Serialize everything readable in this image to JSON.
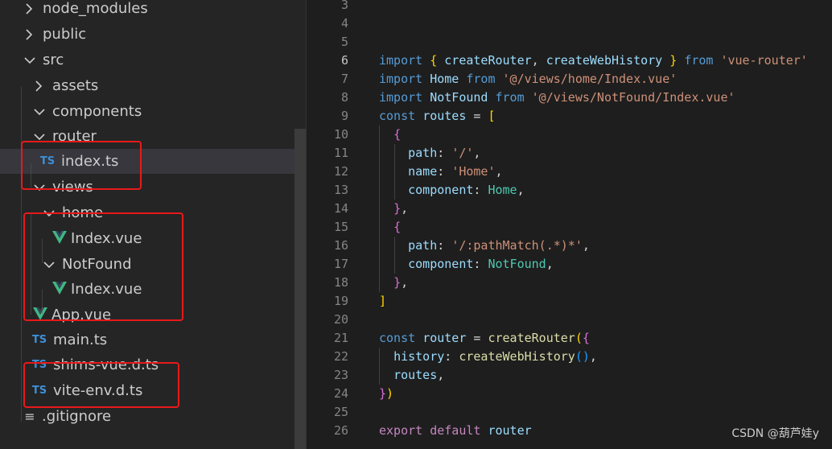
{
  "explorer": {
    "items": [
      {
        "label": "node_modules",
        "icon": "chevron-right-icon"
      },
      {
        "label": "public",
        "icon": "chevron-right-icon"
      },
      {
        "label": "src",
        "icon": "chevron-down-icon"
      },
      {
        "label": "assets",
        "icon": "chevron-right-icon"
      },
      {
        "label": "components",
        "icon": "chevron-down-icon"
      },
      {
        "label": "router",
        "icon": "chevron-down-icon"
      },
      {
        "label": "index.ts",
        "icon": "typescript-file-icon",
        "badge": "TS"
      },
      {
        "label": "views",
        "icon": "chevron-down-icon"
      },
      {
        "label": "home",
        "icon": "chevron-down-icon"
      },
      {
        "label": "Index.vue",
        "icon": "vue-file-icon"
      },
      {
        "label": "NotFound",
        "icon": "chevron-down-icon"
      },
      {
        "label": "Index.vue",
        "icon": "vue-file-icon"
      },
      {
        "label": "App.vue",
        "icon": "vue-file-icon"
      },
      {
        "label": "main.ts",
        "icon": "typescript-file-icon",
        "badge": "TS"
      },
      {
        "label": "shims-vue.d.ts",
        "icon": "typescript-file-icon",
        "badge": "TS"
      },
      {
        "label": "vite-env.d.ts",
        "icon": "typescript-file-icon",
        "badge": "TS"
      },
      {
        "label": ".gitignore",
        "icon": "lines-file-icon"
      }
    ]
  },
  "editor": {
    "line_numbers": [
      "3",
      "4",
      "5",
      "6",
      "7",
      "8",
      "9",
      "10",
      "11",
      "12",
      "13",
      "14",
      "15",
      "16",
      "17",
      "18",
      "19",
      "20",
      "21",
      "22",
      "23",
      "24",
      "25",
      "26"
    ],
    "active_line": "6",
    "lines": [
      [],
      [],
      [],
      [
        [
          "kw",
          "import"
        ],
        [
          "punc",
          " "
        ],
        [
          "b1",
          "{"
        ],
        [
          "punc",
          " "
        ],
        [
          "var",
          "createRouter"
        ],
        [
          "punc",
          ", "
        ],
        [
          "var",
          "createWebHistory"
        ],
        [
          "punc",
          " "
        ],
        [
          "b1",
          "}"
        ],
        [
          "punc",
          " "
        ],
        [
          "kw",
          "from"
        ],
        [
          "punc",
          " "
        ],
        [
          "str",
          "'vue-router'"
        ]
      ],
      [
        [
          "kw",
          "import"
        ],
        [
          "punc",
          " "
        ],
        [
          "var",
          "Home"
        ],
        [
          "punc",
          " "
        ],
        [
          "kw",
          "from"
        ],
        [
          "punc",
          " "
        ],
        [
          "str",
          "'@/views/home/Index.vue'"
        ]
      ],
      [
        [
          "kw",
          "import"
        ],
        [
          "punc",
          " "
        ],
        [
          "var",
          "NotFound"
        ],
        [
          "punc",
          " "
        ],
        [
          "kw",
          "from"
        ],
        [
          "punc",
          " "
        ],
        [
          "str",
          "'@/views/NotFound/Index.vue'"
        ]
      ],
      [
        [
          "kw",
          "const"
        ],
        [
          "punc",
          " "
        ],
        [
          "var",
          "routes"
        ],
        [
          "punc",
          " = "
        ],
        [
          "b1",
          "["
        ]
      ],
      [
        [
          "punc",
          "  "
        ],
        [
          "b2",
          "{"
        ]
      ],
      [
        [
          "punc",
          "    "
        ],
        [
          "var",
          "path"
        ],
        [
          "punc",
          ": "
        ],
        [
          "str",
          "'/'"
        ],
        [
          "punc",
          ","
        ]
      ],
      [
        [
          "punc",
          "    "
        ],
        [
          "var",
          "name"
        ],
        [
          "punc",
          ": "
        ],
        [
          "str",
          "'Home'"
        ],
        [
          "punc",
          ","
        ]
      ],
      [
        [
          "punc",
          "    "
        ],
        [
          "var",
          "component"
        ],
        [
          "punc",
          ": "
        ],
        [
          "typ",
          "Home"
        ],
        [
          "punc",
          ","
        ]
      ],
      [
        [
          "punc",
          "  "
        ],
        [
          "b2",
          "}"
        ],
        [
          "punc",
          ","
        ]
      ],
      [
        [
          "punc",
          "  "
        ],
        [
          "b2",
          "{"
        ]
      ],
      [
        [
          "punc",
          "    "
        ],
        [
          "var",
          "path"
        ],
        [
          "punc",
          ": "
        ],
        [
          "str",
          "'/:pathMatch(.*)*'"
        ],
        [
          "punc",
          ","
        ]
      ],
      [
        [
          "punc",
          "    "
        ],
        [
          "var",
          "component"
        ],
        [
          "punc",
          ": "
        ],
        [
          "typ",
          "NotFound"
        ],
        [
          "punc",
          ","
        ]
      ],
      [
        [
          "punc",
          "  "
        ],
        [
          "b2",
          "}"
        ],
        [
          "punc",
          ","
        ]
      ],
      [
        [
          "b1",
          "]"
        ]
      ],
      [],
      [
        [
          "kw",
          "const"
        ],
        [
          "punc",
          " "
        ],
        [
          "var",
          "router"
        ],
        [
          "punc",
          " = "
        ],
        [
          "fn",
          "createRouter"
        ],
        [
          "b1",
          "("
        ],
        [
          "b2",
          "{"
        ]
      ],
      [
        [
          "punc",
          "  "
        ],
        [
          "var",
          "history"
        ],
        [
          "punc",
          ": "
        ],
        [
          "fn",
          "createWebHistory"
        ],
        [
          "b3",
          "()"
        ],
        [
          "punc",
          ","
        ]
      ],
      [
        [
          "punc",
          "  "
        ],
        [
          "var",
          "routes"
        ],
        [
          "punc",
          ","
        ]
      ],
      [
        [
          "b2",
          "}"
        ],
        [
          "b1",
          ")"
        ]
      ],
      [],
      [
        [
          "ctrl",
          "export"
        ],
        [
          "punc",
          " "
        ],
        [
          "ctrl",
          "default"
        ],
        [
          "punc",
          " "
        ],
        [
          "var",
          "router"
        ]
      ]
    ]
  },
  "watermark": "CSDN @葫芦娃y",
  "colors": {
    "highlight_box": "#e81919",
    "selected_row": "#37373d",
    "ts_badge": "#3d8fd6",
    "vue_logo": "#41b883"
  }
}
